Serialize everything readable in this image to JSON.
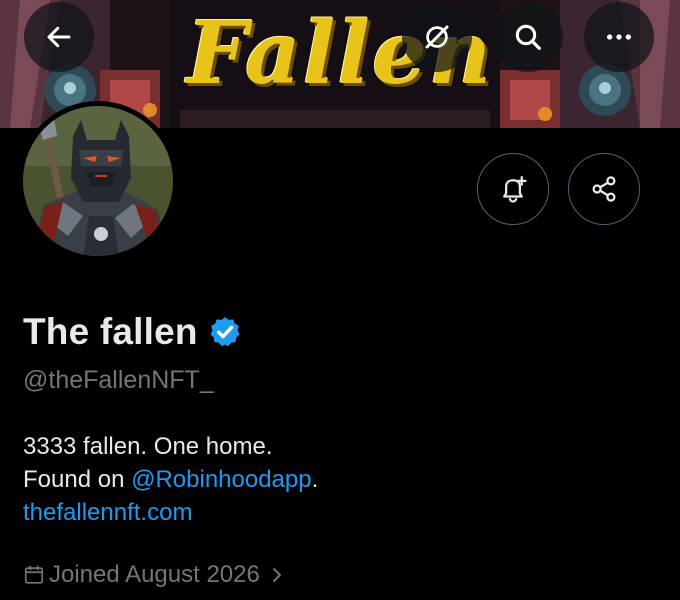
{
  "banner": {
    "title": "Fallen"
  },
  "topbar": {
    "back_icon": "arrow-left-icon",
    "grok_icon": "grok-slash-circle-icon",
    "search_icon": "search-icon",
    "more_icon": "more-dots-icon"
  },
  "profile": {
    "display_name": "The fallen",
    "handle": "@theFallenNFT_",
    "verified": true,
    "verified_color": "#1d9bf0",
    "bio_line1": "3333 fallen. One home.",
    "bio_line2_prefix": "Found on ",
    "bio_mention": "@Robinhoodapp",
    "bio_line2_suffix": ".",
    "website": "thefallennft.com",
    "joined": "Joined August 2026"
  },
  "actions": {
    "notify_icon": "bell-plus-icon",
    "share_icon": "share-icon"
  },
  "colors": {
    "background": "#000000",
    "text_primary": "#e7e9ea",
    "text_secondary": "#71767b",
    "link": "#1d9bf0",
    "banner_gold": "#e8c41a",
    "button_border": "#536471"
  }
}
